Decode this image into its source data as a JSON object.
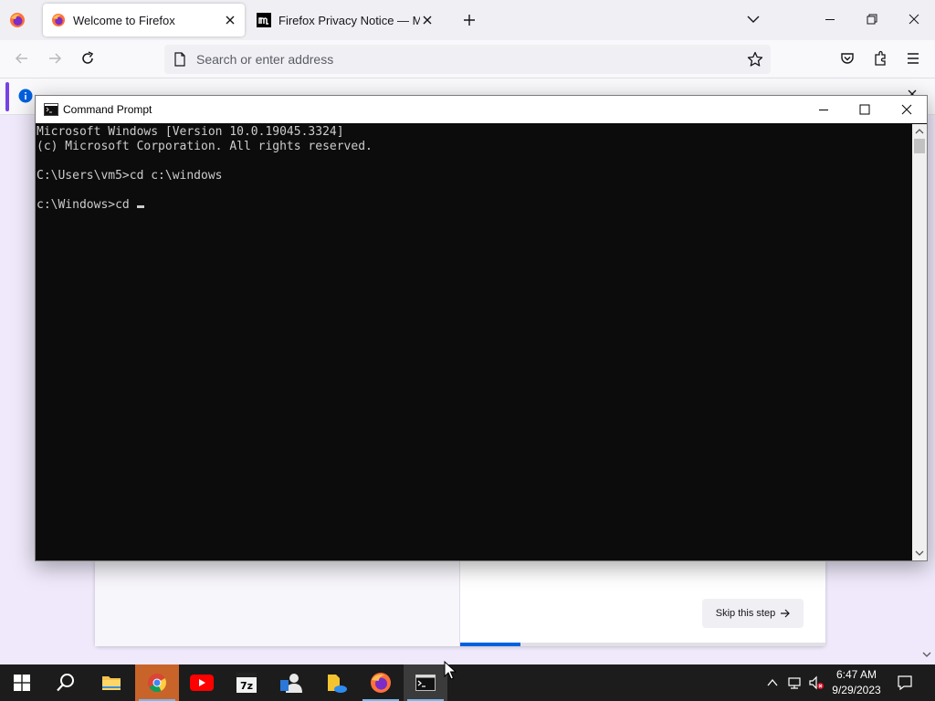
{
  "firefox": {
    "tabs": [
      {
        "title": "Welcome to Firefox",
        "active": true
      },
      {
        "title": "Firefox Privacy Notice — Mozilla",
        "active": false
      }
    ],
    "urlbar_placeholder": "Search or enter address",
    "welcome": {
      "skip_label": "Skip this step",
      "progress_fraction": 0.165
    }
  },
  "cmd": {
    "title": "Command Prompt",
    "lines": [
      "Microsoft Windows [Version 10.0.19045.3324]",
      "(c) Microsoft Corporation. All rights reserved.",
      "",
      "C:\\Users\\vm5>cd c:\\windows",
      "",
      "c:\\Windows>cd "
    ]
  },
  "taskbar": {
    "apps": [
      "start-icon",
      "search-icon",
      "file-explorer-icon",
      "chrome-icon",
      "youtube-icon",
      "7zip-icon",
      "people-icon",
      "onedrive-files-icon",
      "firefox-icon",
      "command-prompt-icon"
    ],
    "clock_time": "6:47 AM",
    "clock_date": "9/29/2023"
  },
  "colors": {
    "accent": "#0060df",
    "taskbar": "#1c1c1c",
    "console_bg": "#0c0c0c",
    "console_text": "#cccccc"
  }
}
